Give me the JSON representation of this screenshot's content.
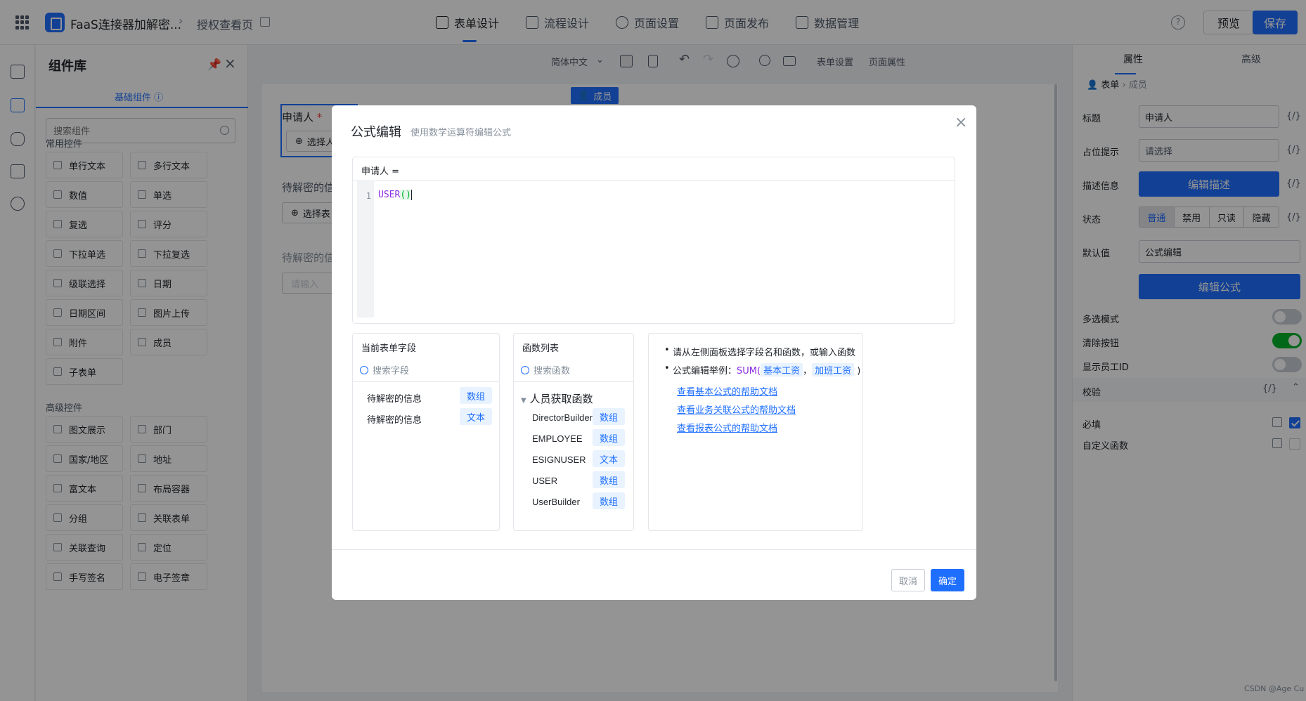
{
  "topbar": {
    "app_name": "FaaS连接器加解密...",
    "page_name": "授权查看页",
    "tabs": [
      "表单设计",
      "流程设计",
      "页面设置",
      "页面发布",
      "数据管理"
    ],
    "help": "?",
    "preview_label": "预览",
    "save_label": "保存"
  },
  "library": {
    "title": "组件库",
    "tab_label": "基础组件 ⓘ",
    "search_placeholder": "搜索组件",
    "section_common": "常用控件",
    "common": [
      "单行文本",
      "多行文本",
      "数值",
      "单选",
      "复选",
      "评分",
      "下拉单选",
      "下拉复选",
      "级联选择",
      "日期",
      "日期区间",
      "图片上传",
      "附件",
      "成员",
      "子表单"
    ],
    "section_advanced": "高级控件",
    "advanced": [
      "图文展示",
      "部门",
      "国家/地区",
      "地址",
      "富文本",
      "布局容器",
      "分组",
      "关联表单",
      "关联查询",
      "定位",
      "手写签名",
      "电子签章"
    ]
  },
  "toolbar": {
    "lang": "简体中文",
    "form_settings": "表单设置",
    "page_props": "页面属性"
  },
  "canvas": {
    "field1_label": "申请人",
    "field1_required": "*",
    "field1_btn": "选择人",
    "field2_label": "待解密的信",
    "field2_btn": "选择表",
    "field3_label": "待解密的信",
    "field3_placeholder": "请输入",
    "member_tag": "成员"
  },
  "props": {
    "tab_props": "属性",
    "tab_advanced": "高级",
    "bc_form": "表单",
    "bc_member": "成员",
    "title_label": "标题",
    "title_value": "申请人",
    "placeholder_label": "占位提示",
    "placeholder_value": "请选择",
    "desc_label": "描述信息",
    "desc_btn": "编辑描述",
    "state_label": "状态",
    "states": [
      "普通",
      "禁用",
      "只读",
      "隐藏"
    ],
    "default_label": "默认值",
    "default_value": "公式编辑",
    "edit_formula": "编辑公式",
    "multi_label": "多选模式",
    "clear_label": "清除按钮",
    "show_id_label": "显示员工ID",
    "verify_label": "校验",
    "required_label": "必填",
    "custom_fn_label": "自定义函数",
    "fx": "{/}"
  },
  "modal": {
    "title": "公式编辑",
    "subtitle": "使用数学运算符编辑公式",
    "editor_head": "申请人 =",
    "line_no": "1",
    "code_fn": "USER",
    "code_paren": "()",
    "fields_title": "当前表单字段",
    "fields_search": "搜索字段",
    "fields": [
      {
        "name": "待解密的信息",
        "type": "数组"
      },
      {
        "name": "待解密的信息",
        "type": "文本"
      }
    ],
    "fn_title": "函数列表",
    "fn_search": "搜索函数",
    "fn_group": "人员获取函数",
    "functions": [
      {
        "name": "DirectorBuilder",
        "type": "数组"
      },
      {
        "name": "EMPLOYEE",
        "type": "数组"
      },
      {
        "name": "ESIGNUSER",
        "type": "文本"
      },
      {
        "name": "USER",
        "type": "数组"
      },
      {
        "name": "UserBuilder",
        "type": "数组"
      }
    ],
    "tip1": "请从左侧面板选择字段名和函数，或输入函数",
    "tip2_prefix": "公式编辑举例：",
    "tip2_fn": "SUM(",
    "tip2_a": "基本工资",
    "tip2_sep": "，",
    "tip2_b": "加班工资",
    "tip2_end": ")",
    "link1": "查看基本公式的帮助文档",
    "link2": "查看业务关联公式的帮助文档",
    "link3": "查看报表公式的帮助文档",
    "cancel": "取消",
    "ok": "确定"
  },
  "watermark": "CSDN @Age Cu"
}
